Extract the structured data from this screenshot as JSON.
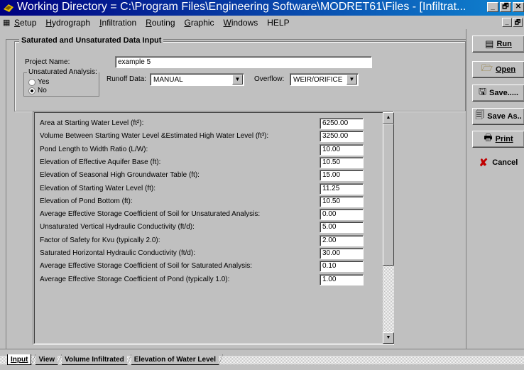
{
  "window": {
    "title": "Working Directory = C:\\Program Files\\Engineering Software\\MODRET61\\Files - [Infiltrat...",
    "buttons": [
      "_",
      "🗗",
      "✕"
    ]
  },
  "menu": {
    "items": [
      {
        "label": "Setup",
        "ul": "S",
        "rest": "etup"
      },
      {
        "label": "Hydrograph",
        "ul": "H",
        "rest": "ydrograph"
      },
      {
        "label": "Infiltration",
        "ul": "I",
        "rest": "nfiltration"
      },
      {
        "label": "Routing",
        "ul": "R",
        "rest": "outing"
      },
      {
        "label": "Graphic",
        "ul": "G",
        "rest": "raphic"
      },
      {
        "label": "Windows",
        "ul": "W",
        "rest": "indows"
      },
      {
        "label": "HELP",
        "ul": "",
        "rest": "HELP"
      }
    ],
    "mdi_buttons": [
      "_",
      "🗗"
    ]
  },
  "form": {
    "group_title": "Saturated and Unsaturated Data Input",
    "project_name_label": "Project Name:",
    "project_name_value": "example 5",
    "unsat_group_label": "Unsaturated Analysis:",
    "radio_yes": "Yes",
    "radio_no": "No",
    "runoff_label": "Runoff Data:",
    "runoff_value": "MANUAL",
    "overflow_label": "Overflow:",
    "overflow_value": "WEIR/ORIFICE"
  },
  "parameters": [
    {
      "label": "Area at Starting Water Level (ft²):",
      "value": "6250.00"
    },
    {
      "label": "Volume Between Starting Water Level &Estimated High Water Level (ft³):",
      "value": "3250.00"
    },
    {
      "label": "Pond Length to Width Ratio (L/W):",
      "value": "10.00"
    },
    {
      "label": "Elevation of Effective Aquifer Base (ft):",
      "value": "10.50"
    },
    {
      "label": "Elevation of Seasonal High Groundwater Table (ft):",
      "value": "15.00"
    },
    {
      "label": "Elevation of Starting Water Level (ft):",
      "value": "11.25"
    },
    {
      "label": "Elevation of Pond Bottom (ft):",
      "value": "10.50"
    },
    {
      "label": "Average Effective Storage Coefficient of Soil for Unsaturated Analysis:",
      "value": "0.00"
    },
    {
      "label": "Unsaturated Vertical Hydraulic Conductivity (ft/d):",
      "value": "5.00"
    },
    {
      "label": "Factor of Safety for Kvu (typically 2.0):",
      "value": "2.00"
    },
    {
      "label": "Saturated Horizontal Hydraulic Conductivity (ft/d):",
      "value": "30.00"
    },
    {
      "label": "Average Effective Storage Coefficient of Soil for Saturated Analysis:",
      "value": "0.10"
    },
    {
      "label": "Average Effective Storage Coefficient of Pond (typically 1.0):",
      "value": "1.00"
    }
  ],
  "actions": {
    "run": "Run",
    "open": "Open",
    "save": "Save.....",
    "save_as": "Save As..",
    "print": "Print",
    "cancel": "Cancel"
  },
  "tabs": [
    "Input",
    "View",
    "Volume Infiltrated",
    "Elevation of Water Level"
  ],
  "active_tab": "Input"
}
